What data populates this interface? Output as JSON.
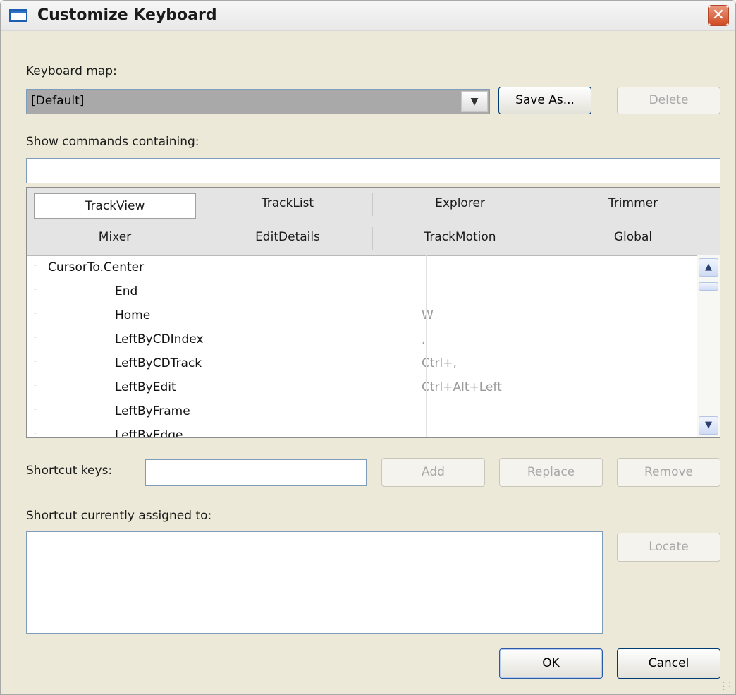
{
  "window": {
    "title": "Customize Keyboard",
    "close_glyph": "✕",
    "icon": "window-icon"
  },
  "keyboard_map": {
    "label": "Keyboard map:",
    "value": "[Default]",
    "dropdown_glyph": "▼",
    "save_as_label": "Save As...",
    "delete_label": "Delete"
  },
  "filter": {
    "label": "Show commands containing:",
    "value": ""
  },
  "tabs": [
    {
      "label": "TrackView",
      "active": true
    },
    {
      "label": "TrackList",
      "active": false
    },
    {
      "label": "Explorer",
      "active": false
    },
    {
      "label": "Trimmer",
      "active": false
    },
    {
      "label": "Mixer",
      "active": false
    },
    {
      "label": "EditDetails",
      "active": false
    },
    {
      "label": "TrackMotion",
      "active": false
    },
    {
      "label": "Global",
      "active": false
    }
  ],
  "commands": [
    {
      "name": "CursorTo.Center",
      "shortcut": "",
      "indent": false
    },
    {
      "name": "End",
      "shortcut": "",
      "indent": true
    },
    {
      "name": "Home",
      "shortcut": "W",
      "indent": true
    },
    {
      "name": "LeftByCDIndex",
      "shortcut": ",",
      "indent": true
    },
    {
      "name": "LeftByCDTrack",
      "shortcut": "Ctrl+,",
      "indent": true
    },
    {
      "name": "LeftByEdit",
      "shortcut": "Ctrl+Alt+Left",
      "indent": true
    },
    {
      "name": "LeftByFrame",
      "shortcut": "",
      "indent": true
    },
    {
      "name": "LeftByEdge",
      "shortcut": "",
      "indent": true
    }
  ],
  "scrollbar": {
    "up_glyph": "▲",
    "down_glyph": "▼"
  },
  "shortcut": {
    "label": "Shortcut keys:",
    "value": "",
    "add_label": "Add",
    "replace_label": "Replace",
    "remove_label": "Remove"
  },
  "assigned": {
    "label": "Shortcut currently assigned to:",
    "locate_label": "Locate"
  },
  "footer": {
    "ok_label": "OK",
    "cancel_label": "Cancel"
  }
}
